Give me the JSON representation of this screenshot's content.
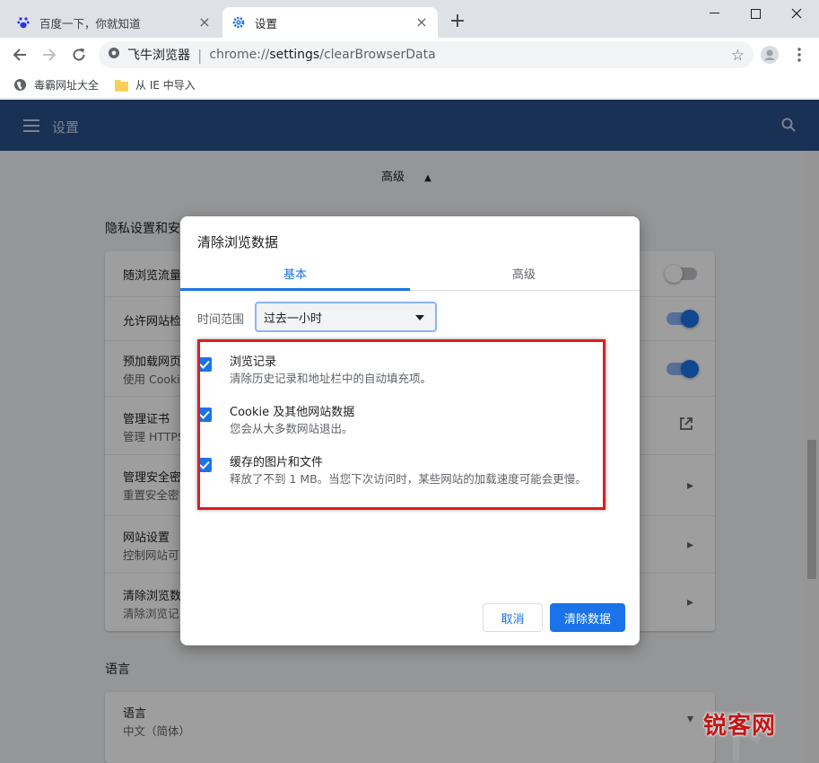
{
  "browser": {
    "tabs": [
      {
        "title": "百度一下，你就知道",
        "icon": "baidu-paw-icon",
        "active": false
      },
      {
        "title": "设置",
        "icon": "settings-gear-icon",
        "active": true
      }
    ],
    "omnibox": {
      "site_name": "飞牛浏览器",
      "url_prefix": "chrome://",
      "url_bold": "settings",
      "url_suffix": "/clearBrowserData"
    },
    "bookmarks": [
      {
        "label": "毒霸网址大全",
        "icon": "globe-icon"
      },
      {
        "label": "从 IE 中导入",
        "icon": "folder-icon"
      }
    ]
  },
  "settings": {
    "header_title": "设置",
    "advanced_label": "高级",
    "privacy_section_label": "隐私设置和安",
    "privacy_rows": [
      {
        "title": "随浏览流量",
        "subtitle": "",
        "control": "toggle-off"
      },
      {
        "title": "允许网站检",
        "subtitle": "",
        "control": "toggle-on"
      },
      {
        "title": "预加载网页",
        "subtitle": "使用 Cookie",
        "control": "toggle-on"
      },
      {
        "title": "管理证书",
        "subtitle": "管理 HTTPS",
        "control": "external"
      },
      {
        "title": "管理安全密",
        "subtitle": "重置安全密",
        "control": "arrow"
      },
      {
        "title": "网站设置",
        "subtitle": "控制网站可",
        "control": "arrow"
      },
      {
        "title": "清除浏览数",
        "subtitle": "清除浏览记",
        "control": "arrow"
      }
    ],
    "language_section_label": "语言",
    "language_row": {
      "title": "语言",
      "subtitle": "中文（简体）"
    }
  },
  "dialog": {
    "title": "清除浏览数据",
    "tabs": [
      "基本",
      "高级"
    ],
    "time_range_label": "时间范围",
    "time_range_value": "过去一小时",
    "items": [
      {
        "title": "浏览记录",
        "description": "清除历史记录和地址栏中的自动填充项。",
        "checked": true
      },
      {
        "title": "Cookie 及其他网站数据",
        "description": "您会从大多数网站退出。",
        "checked": true
      },
      {
        "title": "缓存的图片和文件",
        "description": "释放了不到 1 MB。当您下次访问时，某些网站的加载速度可能会更慢。",
        "checked": true
      }
    ],
    "cancel_label": "取消",
    "confirm_label": "清除数据"
  },
  "watermark": {
    "text": "锐客网"
  },
  "colors": {
    "accent": "#1a73e8",
    "header": "#2a4f8c",
    "highlight": "#e21b22"
  }
}
